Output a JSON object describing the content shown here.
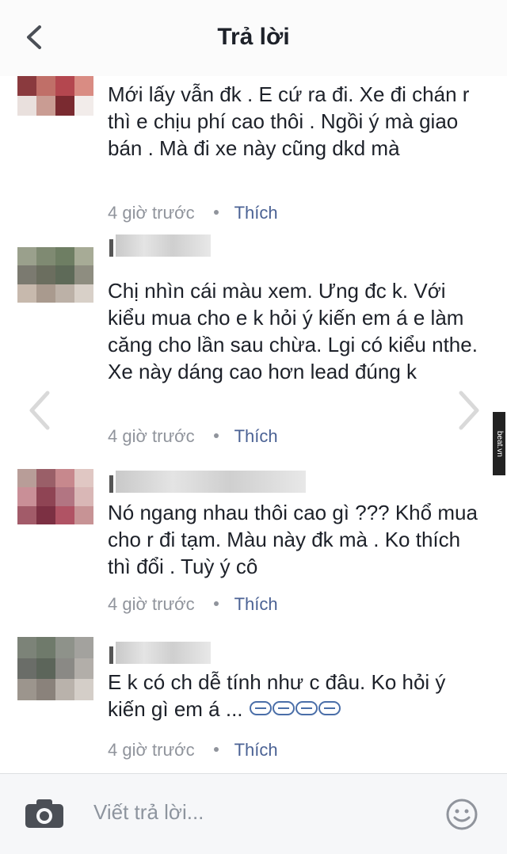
{
  "header": {
    "title": "Trả lời"
  },
  "comments": [
    {
      "text": "Mới lấy vẫn đk .  E cứ ra đi. Xe đi chán r thì e chịu phí cao thôi . Ngồi ý mà giao bán . Mà đi xe này cũng dkd mà",
      "time": "4 giờ trước",
      "like": "Thích"
    },
    {
      "text": "Chị nhìn cái màu xem. Ưng đc k. Với kiểu mua cho e k hỏi ý kiến em á e làm căng cho lần sau chừa. Lgi có kiểu nthe. Xe này dáng cao hơn lead đúng k",
      "time": "4 giờ trước",
      "like": "Thích"
    },
    {
      "text": "Nó ngang nhau thôi cao gì ??? Khổ mua cho r đi tạm. Màu này đk mà . Ko thích thì đổi .   Tuỳ ý cô",
      "time": "4 giờ trước",
      "like": "Thích"
    },
    {
      "text": "E k có ch dễ tính như c đâu. Ko hỏi ý kiến gì em á ...",
      "time": "4 giờ trước",
      "like": "Thích"
    }
  ],
  "watermark": "beat.vn",
  "composer": {
    "placeholder": "Viết trả lời..."
  },
  "icons": [
    "back-icon",
    "prev-arrow-icon",
    "next-arrow-icon",
    "camera-icon",
    "smiley-icon",
    "mouth-emoji-icon"
  ]
}
